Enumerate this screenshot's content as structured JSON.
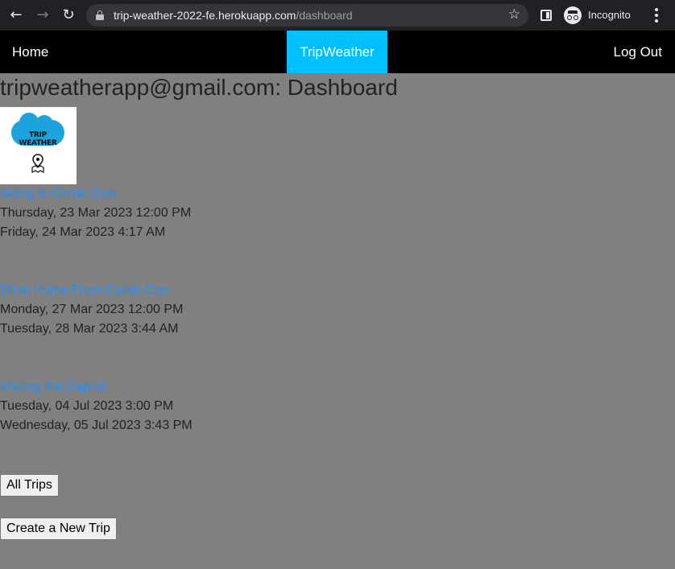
{
  "browser": {
    "url_host": "trip-weather-2022-fe.herokuapp.com",
    "url_path": "/dashboard",
    "incognito_label": "Incognito"
  },
  "navbar": {
    "home_label": "Home",
    "brand_label": "TripWeather",
    "logout_label": "Log Out"
  },
  "page": {
    "title": "tripweatherapp@gmail.com: Dashboard",
    "logo_text": "TRIP WEATHER"
  },
  "trips": [
    {
      "name": "Going to Comic Con",
      "start": "Thursday, 23 Mar 2023 12:00 PM",
      "end": "Friday, 24 Mar 2023 4:17 AM"
    },
    {
      "name": "Drive Home From Comic Con",
      "start": "Monday, 27 Mar 2023 12:00 PM",
      "end": "Tuesday, 28 Mar 2023 3:44 AM"
    },
    {
      "name": "Visiting the Capitol",
      "start": "Tuesday, 04 Jul 2023 3:00 PM",
      "end": "Wednesday, 05 Jul 2023 3:43 PM"
    }
  ],
  "buttons": {
    "all_trips": "All Trips",
    "create_trip": "Create a New Trip"
  },
  "colors": {
    "brand": "#00bfff",
    "link": "#1e90ff",
    "page_bg": "#808080"
  }
}
